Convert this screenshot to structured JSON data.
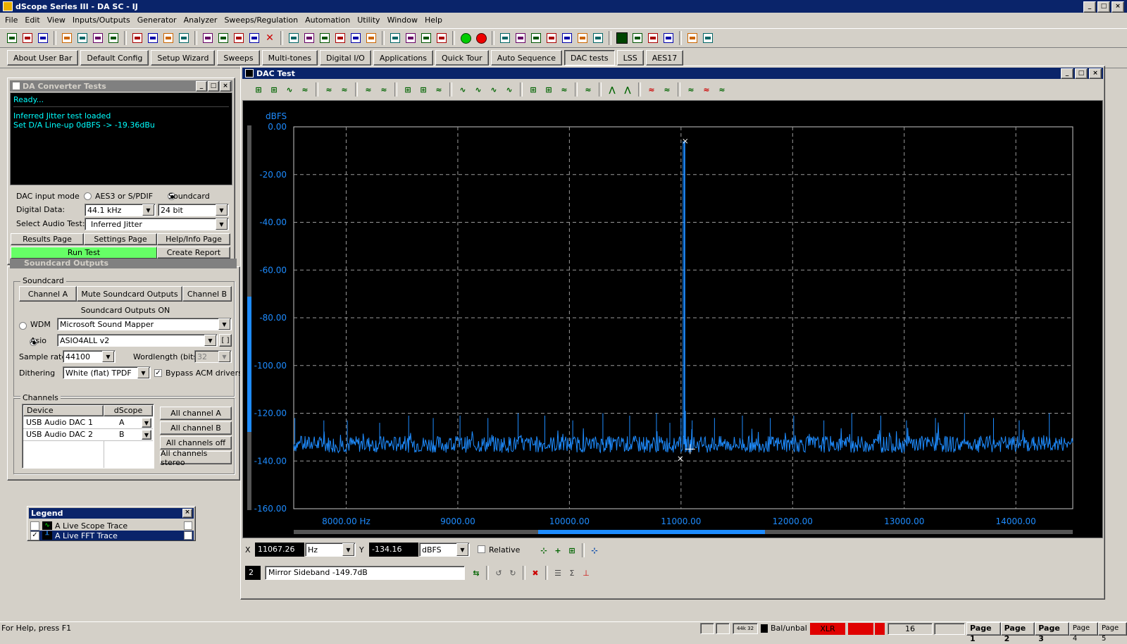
{
  "app": {
    "title": "dScope Series III - DA SC - IJ",
    "window_buttons": [
      "_",
      "□",
      "×"
    ]
  },
  "menu": [
    "File",
    "Edit",
    "View",
    "Inputs/Outputs",
    "Generator",
    "Analyzer",
    "Sweeps/Regulation",
    "Automation",
    "Utility",
    "Window",
    "Help"
  ],
  "toolbar_icons": [
    "open-icon",
    "save-icon",
    "save-as-icon",
    "out1-icon",
    "out2-icon",
    "out3-icon",
    "out4-icon",
    "gen-a-icon",
    "gen-b-icon",
    "gen-c-icon",
    "gen-d-icon",
    "in1-icon",
    "in2-icon",
    "in3-icon",
    "in4-icon",
    "stop-icon",
    "scope-a-icon",
    "scope-b-icon",
    "scope-c-icon",
    "meter-a-icon",
    "meter-b-icon",
    "meter-c-icon",
    "ch-a-icon",
    "ch-b-icon",
    "ch-c-icon",
    "ch-d-icon",
    "run-icon",
    "record-icon",
    "sweep-a-icon",
    "sweep-b-icon",
    "filter-a-icon",
    "filter-b-icon",
    "filter-c-icon",
    "filter-d-icon",
    "filter-e-icon",
    "chart-icon",
    "curve-a-icon",
    "curve-b-icon",
    "curve-c-icon",
    "report-icon",
    "print-icon"
  ],
  "quickbar": [
    {
      "label": "About User Bar",
      "pressed": false
    },
    {
      "label": "Default Config",
      "pressed": false
    },
    {
      "label": "Setup Wizard",
      "pressed": false
    },
    {
      "label": "Sweeps",
      "pressed": false
    },
    {
      "label": "Multi-tones",
      "pressed": false
    },
    {
      "label": "Digital I/O",
      "pressed": false
    },
    {
      "label": "Applications",
      "pressed": false
    },
    {
      "label": "Quick Tour",
      "pressed": false
    },
    {
      "label": "Auto Sequence",
      "pressed": false
    },
    {
      "label": "DAC tests",
      "pressed": true
    },
    {
      "label": "LSS",
      "pressed": false
    },
    {
      "label": "AES17",
      "pressed": false
    }
  ],
  "dac_panel": {
    "title": "DA Converter Tests",
    "console_lines": [
      "Ready...",
      "Inferred Jitter test loaded",
      "Set D/A Line-up 0dBFS -> -19.36dBu"
    ],
    "input_mode_label": "DAC input mode",
    "aes_label": "AES3 or S/PDIF",
    "soundcard_label": "Soundcard",
    "digital_data_label": "Digital Data:",
    "sample_rate": "44.1 kHz",
    "bits": "24 bit",
    "select_test_label": "Select Audio Test:",
    "selected_test": "Inferred Jitter",
    "results_btn": "Results Page",
    "settings_btn": "Settings Page",
    "help_btn": "Help/Info Page",
    "run_btn": "Run Test",
    "report_btn": "Create Report"
  },
  "soundcard_panel": {
    "title": "Soundcard Outputs",
    "group_label": "Soundcard",
    "channel_a_btn": "Channel A",
    "mute_btn": "Mute Soundcard Outputs",
    "channel_b_btn": "Channel B",
    "status": "Soundcard Outputs ON",
    "wdm_label": "WDM",
    "wdm_device": "Microsoft Sound Mapper",
    "asio_label": "Asio",
    "asio_device": "ASIO4ALL v2",
    "asio_config_btn": "[ ]",
    "sample_rate_label": "Sample rate",
    "sample_rate": "44100",
    "wordlength_label": "Wordlength (bits)",
    "wordlength": "32",
    "dithering_label": "Dithering",
    "dithering": "White (flat) TPDF",
    "bypass_label": "Bypass ACM drivers",
    "channels_label": "Channels",
    "col_device": "Device",
    "col_dscope": "dScope",
    "rows": [
      {
        "device": "USB Audio DAC",
        "num": "1",
        "dscope": "A"
      },
      {
        "device": "USB Audio DAC",
        "num": "2",
        "dscope": "B"
      }
    ],
    "all_a_btn": "All channel A",
    "all_b_btn": "All channel B",
    "all_off_btn": "All channels off",
    "all_stereo_btn": "All channels stereo"
  },
  "legend": {
    "title": "Legend",
    "items": [
      {
        "label": "A Live Scope Trace",
        "checked": false,
        "selected": false
      },
      {
        "label": "A Live FFT Trace",
        "checked": true,
        "selected": true
      }
    ]
  },
  "dac_test": {
    "title": "DAC Test",
    "cursor": {
      "x_label": "X",
      "x_value": "11067.26",
      "x_unit": "Hz",
      "y_label": "Y",
      "y_value": "-134.16",
      "y_unit": "dBFS",
      "relative_label": "Relative"
    },
    "marker": {
      "index": "2",
      "text": "Mirror Sideband -149.7dB"
    }
  },
  "chart_data": {
    "type": "line",
    "title": "",
    "ylabel": "dBFS",
    "xlabel": "",
    "x_ticks": [
      8000,
      9000,
      10000,
      11000,
      12000,
      13000,
      14000
    ],
    "x_tick_labels": [
      "8000.00 Hz",
      "9000.00",
      "10000.00",
      "11000.00",
      "12000.00",
      "13000.00",
      "14000.00"
    ],
    "y_ticks": [
      0,
      -20,
      -40,
      -60,
      -80,
      -100,
      -120,
      -140,
      -160
    ],
    "y_tick_labels": [
      "0.00",
      "-20.00",
      "-40.00",
      "-60.00",
      "-80.00",
      "-100.00",
      "-120.00",
      "-140.00",
      "-160.00"
    ],
    "xlim": [
      7530,
      14510
    ],
    "ylim": [
      -160,
      0
    ],
    "grid": true,
    "series": [
      {
        "color": "#1e8cff",
        "noise_floor": -133,
        "main_peak": {
          "x": 11025,
          "y": -6
        },
        "spurs": [
          {
            "x": 7540,
            "y": -122
          },
          {
            "x": 7800,
            "y": -123
          },
          {
            "x": 8010,
            "y": -123
          },
          {
            "x": 8300,
            "y": -124
          },
          {
            "x": 8560,
            "y": -121
          },
          {
            "x": 8780,
            "y": -122
          },
          {
            "x": 9020,
            "y": -121
          },
          {
            "x": 9270,
            "y": -122
          },
          {
            "x": 9540,
            "y": -120
          },
          {
            "x": 9780,
            "y": -121
          },
          {
            "x": 10030,
            "y": -123
          },
          {
            "x": 10300,
            "y": -120
          },
          {
            "x": 10540,
            "y": -121
          },
          {
            "x": 10780,
            "y": -120
          },
          {
            "x": 10900,
            "y": -124
          },
          {
            "x": 11000,
            "y": -122
          },
          {
            "x": 11040,
            "y": -119
          },
          {
            "x": 11100,
            "y": -123
          },
          {
            "x": 11300,
            "y": -122
          },
          {
            "x": 11550,
            "y": -121
          },
          {
            "x": 11800,
            "y": -122
          },
          {
            "x": 12010,
            "y": -121
          },
          {
            "x": 12280,
            "y": -123
          },
          {
            "x": 12530,
            "y": -120
          },
          {
            "x": 12790,
            "y": -121
          },
          {
            "x": 13020,
            "y": -123
          },
          {
            "x": 13280,
            "y": -122
          },
          {
            "x": 13540,
            "y": -120
          },
          {
            "x": 13800,
            "y": -122
          },
          {
            "x": 14030,
            "y": -123
          },
          {
            "x": 14300,
            "y": -120
          }
        ]
      }
    ]
  },
  "status": {
    "help": "For Help, press F1",
    "rate": "44k 32",
    "bal": "Bal/unbal",
    "xlr": "XLR",
    "val": "16",
    "pages": [
      "Page 1",
      "Page 2",
      "Page 3",
      "Page 4",
      "Page 5"
    ]
  }
}
